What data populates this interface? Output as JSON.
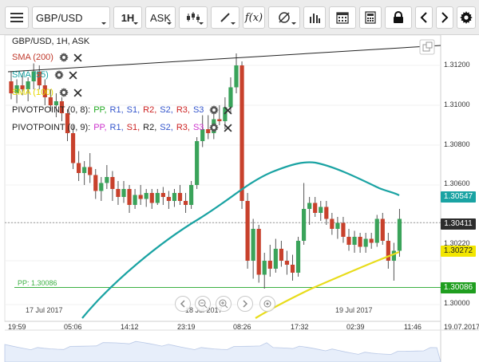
{
  "toolbar": {
    "symbol": "GBP/USD",
    "timeframe": "1H",
    "price_type": "ASK",
    "icons": [
      "menu-icon",
      "candle-type-icon",
      "draw-line-icon",
      "function-icon",
      "indicators-icon",
      "volume-bars-icon",
      "calendar-icon",
      "calculator-icon",
      "lock-icon",
      "scroll-left-icon",
      "scroll-right-icon",
      "settings-icon"
    ]
  },
  "chart": {
    "header": "GBP/USD, 1H, ASK",
    "indicators": [
      {
        "label": "SMA (200)",
        "color": "#c0392b"
      },
      {
        "label": "SMA (55)",
        "color": "#1aa3a3"
      },
      {
        "label": "SMA (100)",
        "color": "#e5d800"
      }
    ],
    "pivots": [
      {
        "label": "PIVOTPOINT (0, 8):",
        "items": [
          "PP,",
          "R1,",
          "S1,",
          "R2,",
          "S2,",
          "R3,",
          "S3"
        ],
        "colors": [
          "#22aa22",
          "#3355cc",
          "#3355cc",
          "#cc2222",
          "#3355cc",
          "#cc2222",
          "#3355cc"
        ]
      },
      {
        "label": "PIVOTPOINT (0, 9):",
        "items": [
          "PP,",
          "R1,",
          "S1,",
          "R2,",
          "S2,",
          "R3,",
          "S3"
        ],
        "colors": [
          "#cc33cc",
          "#3355cc",
          "#cc2222",
          "#222222",
          "#3355cc",
          "#cc2222",
          "#cc33cc"
        ]
      }
    ],
    "pp_label": "PP: 1.30086",
    "y_ticks": [
      "1.31200",
      "1.31000",
      "1.30800",
      "1.30600",
      "1.30400",
      "1.30220",
      "1.30000"
    ],
    "x_ticks": [
      "19:59",
      "05:06",
      "14:12",
      "23:19",
      "08:26",
      "17:32",
      "02:39",
      "11:46"
    ],
    "date_tags": [
      "17 Jul 2017",
      "18 Jul 2017",
      "19 Jul 2017"
    ],
    "current_date": "19.07.2017",
    "price_tags": [
      {
        "value": "1.30547",
        "color": "#1aa3a3",
        "text": "#ffffff"
      },
      {
        "value": "1.30411",
        "color": "#2c2c2c",
        "text": "#ffffff"
      },
      {
        "value": "1.30272",
        "color": "#f2e600",
        "text": "#222222"
      },
      {
        "value": "1.30086",
        "color": "#1f9e1f",
        "text": "#ffffff"
      }
    ],
    "colors": {
      "up": "#3aa35a",
      "down": "#c8412c",
      "sma55": "#1aa3a3",
      "sma100": "#e8dc1b",
      "pp": "#3cb043"
    }
  }
}
